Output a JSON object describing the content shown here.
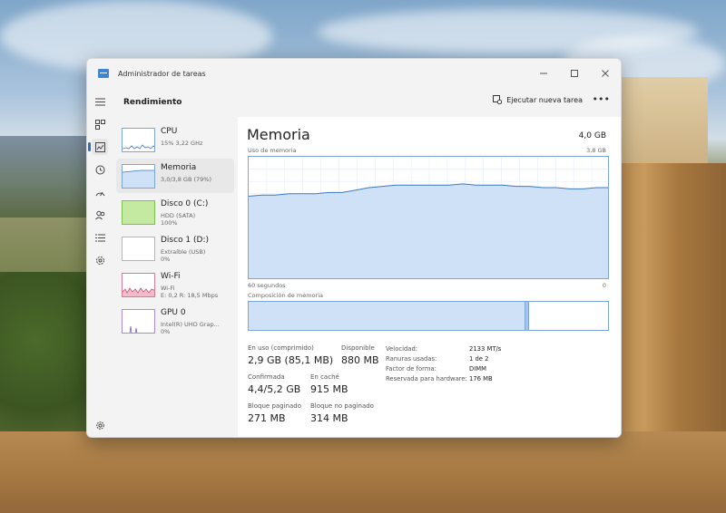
{
  "window": {
    "title": "Administrador de tareas"
  },
  "header": {
    "title": "Rendimiento",
    "run_task_label": "Ejecutar nueva tarea",
    "more_label": "•••"
  },
  "perf_items": [
    {
      "name": "CPU",
      "sub1": "15%  3,22 GHz",
      "sub2": ""
    },
    {
      "name": "Memoria",
      "sub1": "3,0/3,8 GB (79%)",
      "sub2": ""
    },
    {
      "name": "Disco 0 (C:)",
      "sub1": "HDD (SATA)",
      "sub2": "100%"
    },
    {
      "name": "Disco 1 (D:)",
      "sub1": "Extraíble (USB)",
      "sub2": "0%"
    },
    {
      "name": "Wi-Fi",
      "sub1": "Wi-Fi",
      "sub2": "E: 0,2  R: 18,5 Mbps"
    },
    {
      "name": "GPU 0",
      "sub1": "Intel(R) UHD Grap...",
      "sub2": "0%"
    }
  ],
  "memory": {
    "title": "Memoria",
    "total": "4,0 GB",
    "usage_label": "Uso de memoria",
    "usage_max": "3,8 GB",
    "time_left": "60 segundos",
    "time_right": "0",
    "composition_label": "Composición de memoria",
    "composition": {
      "in_use": 0.77,
      "modified": 0.01
    },
    "usage_history": [
      0.68,
      0.69,
      0.69,
      0.7,
      0.7,
      0.7,
      0.71,
      0.71,
      0.73,
      0.75,
      0.76,
      0.77,
      0.77,
      0.77,
      0.77,
      0.77,
      0.78,
      0.77,
      0.77,
      0.77,
      0.76,
      0.76,
      0.75,
      0.75,
      0.74,
      0.74,
      0.75,
      0.75
    ]
  },
  "stats": {
    "in_use_label": "En uso (comprimido)",
    "in_use_value": "2,9 GB (85,1 MB)",
    "available_label": "Disponible",
    "available_value": "880 MB",
    "committed_label": "Confirmada",
    "committed_value": "4,4/5,2 GB",
    "cached_label": "En caché",
    "cached_value": "915 MB",
    "paged_label": "Bloque paginado",
    "paged_value": "271 MB",
    "nonpaged_label": "Bloque no paginado",
    "nonpaged_value": "314 MB"
  },
  "details": [
    {
      "k": "Velocidad:",
      "v": "2133 MT/s"
    },
    {
      "k": "Ranuras usadas:",
      "v": "1 de 2"
    },
    {
      "k": "Factor de forma:",
      "v": "DIMM"
    },
    {
      "k": "Reservada para hardware:",
      "v": "176 MB"
    }
  ],
  "colors": {
    "accent": "#2b6cc4",
    "graph_fill": "#cfe1f7",
    "graph_line": "#3b79c7",
    "disk_fill": "#c4e9a0",
    "wifi_fill": "#e58aa4"
  }
}
